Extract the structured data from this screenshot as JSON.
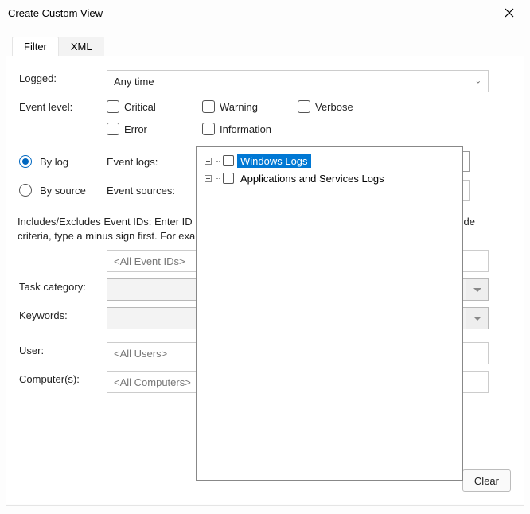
{
  "window": {
    "title": "Create Custom View"
  },
  "tabs": {
    "filter": "Filter",
    "xml": "XML"
  },
  "labels": {
    "logged": "Logged:",
    "eventLevel": "Event level:",
    "byLog": "By log",
    "bySource": "By source",
    "eventLogs": "Event logs:",
    "eventSources": "Event sources:",
    "idsText": "Includes/Excludes Event IDs: Enter ID numbers and/or ID ranges separated by commas. To exclude criteria, type a minus sign first. For example 1,3,5-99,-76",
    "taskCategory": "Task category:",
    "keywords": "Keywords:",
    "user": "User:",
    "computers": "Computer(s):"
  },
  "logged": {
    "value": "Any time"
  },
  "levels": {
    "critical": "Critical",
    "warning": "Warning",
    "verbose": "Verbose",
    "error": "Error",
    "information": "Information"
  },
  "filterMode": "byLog",
  "placeholders": {
    "ids": "<All Event IDs>",
    "users": "<All Users>",
    "computers": "<All Computers>"
  },
  "buttons": {
    "clear": "Clear"
  },
  "tree": {
    "items": [
      {
        "label": "Windows Logs",
        "selected": true
      },
      {
        "label": "Applications and Services Logs",
        "selected": false
      }
    ]
  }
}
